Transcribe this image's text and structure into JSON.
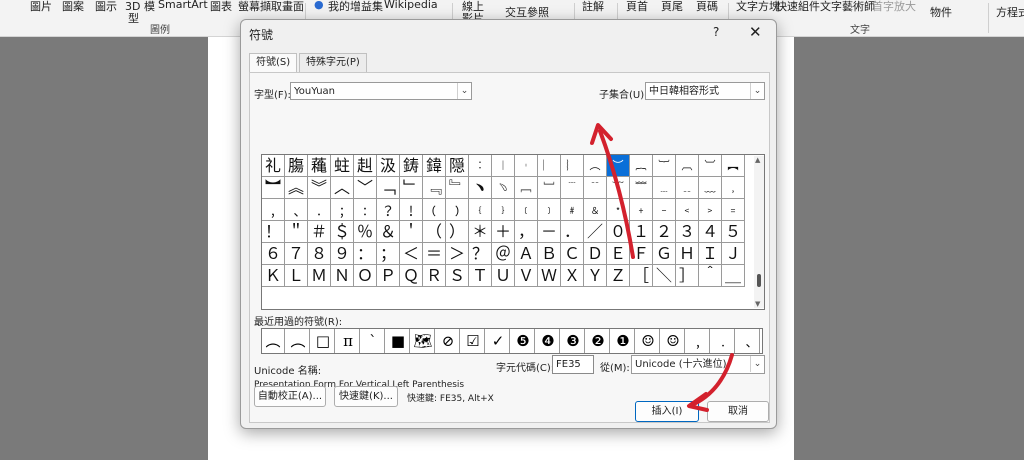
{
  "ribbon": {
    "top_items": [
      "圖片",
      "圖案",
      "圖示",
      "3D 模",
      "SmartArt",
      "圖表",
      "螢幕擷取畫面",
      "我的增益集",
      "Wikipedia",
      "線上",
      "交互參照",
      "註解",
      "頁首",
      "頁尾",
      "頁碼",
      "文字方塊",
      "快速組件",
      "文字藝術師",
      "首字放大",
      "物件",
      "方程式"
    ],
    "sub_items": [
      "型",
      "影片"
    ],
    "group_labels": [
      "圖例",
      "文字"
    ]
  },
  "dialog": {
    "title": "符號",
    "help": "?",
    "close": "✕",
    "tabs": [
      "符號(S)",
      "特殊字元(P)"
    ],
    "font_label": "字型(F):",
    "font_value": "YouYuan",
    "subset_label": "子集合(U):",
    "subset_value": "中日韓相容形式",
    "symbol_rows": [
      [
        "礼",
        "膓",
        "蘒",
        "蛀",
        "赳",
        "汲",
        "鋳",
        "鍏",
        "隠",
        "︰",
        "︱",
        "︲",
        "︳",
        "︴",
        "︵",
        "︶",
        "︷",
        "︸",
        "︹",
        "︺",
        "︻"
      ],
      [
        "︼",
        "︽",
        "︾",
        "︿",
        "﹀",
        "﹁",
        "﹂",
        "﹃",
        "﹄",
        "﹅",
        "﹆",
        "﹇",
        "﹈",
        "﹉",
        "﹊",
        "﹋",
        "﹌",
        "﹍",
        "﹎",
        "﹏",
        "﹐"
      ],
      [
        "﹐",
        "﹑",
        "﹒",
        "﹔",
        "﹕",
        "﹖",
        "﹗",
        "﹙",
        "﹚",
        "﹛",
        "﹜",
        "﹝",
        "﹞",
        "﹟",
        "﹠",
        "﹡",
        "﹢",
        "﹣",
        "﹤",
        "﹥",
        "﹦"
      ],
      [
        "！",
        "＂",
        "＃",
        "＄",
        "％",
        "＆",
        "＇",
        "（",
        "）",
        "＊",
        "＋",
        "，",
        "－",
        "．",
        "／",
        "０",
        "１",
        "２",
        "３",
        "４",
        "５"
      ],
      [
        "６",
        "７",
        "８",
        "９",
        "：",
        "；",
        "＜",
        "＝",
        "＞",
        "？",
        "＠",
        "Ａ",
        "Ｂ",
        "Ｃ",
        "Ｄ",
        "Ｅ",
        "Ｆ",
        "Ｇ",
        "Ｈ",
        "Ｉ",
        "Ｊ"
      ],
      [
        "Ｋ",
        "Ｌ",
        "Ｍ",
        "Ｎ",
        "Ｏ",
        "Ｐ",
        "Ｑ",
        "Ｒ",
        "Ｓ",
        "Ｔ",
        "Ｕ",
        "Ｖ",
        "Ｗ",
        "Ｘ",
        "Ｙ",
        "Ｚ",
        "［",
        "＼",
        "］",
        "＾",
        "＿"
      ]
    ],
    "selected_symbol": "︵",
    "recent_label": "最近用過的符號(R):",
    "recent_symbols": [
      "︵",
      "︵",
      "□",
      "π",
      "`",
      "■",
      "🗺",
      "⊘",
      "☑",
      "✓",
      "❺",
      "❹",
      "❸",
      "❷",
      "❶",
      "☺",
      "☺",
      "﹐",
      "﹒",
      "﹑"
    ],
    "unicode_name_label": "Unicode 名稱:",
    "unicode_name": "Presentation Form For Vertical Left Parenthesis",
    "char_code_label": "字元代碼(C):",
    "char_code": "FE35",
    "from_label": "從(M):",
    "from_value": "Unicode (十六進位)",
    "autocorrect_button": "自動校正(A)...",
    "shortcut_button": "快速鍵(K)...",
    "shortcut_info": "快速鍵: FE35, Alt+X",
    "insert_button": "插入(I)",
    "cancel_button": "取消"
  },
  "colors": {
    "selection": "#0a6fd8",
    "annotation_arrow": "#d3212d",
    "default_button_border": "#0067c0"
  }
}
